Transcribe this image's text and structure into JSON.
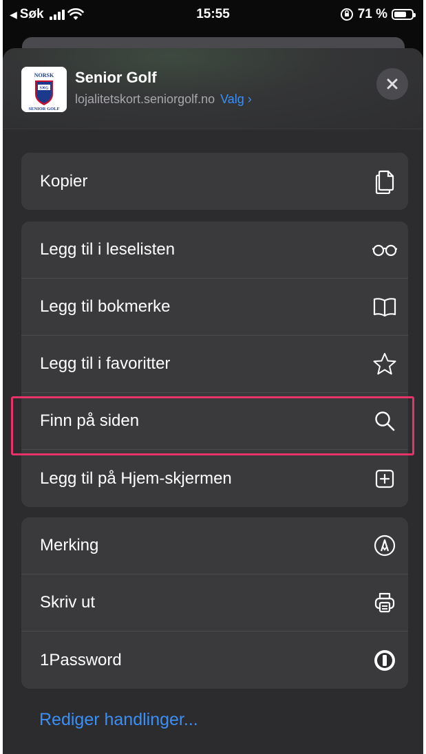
{
  "status_bar": {
    "back_label": "Søk",
    "time": "15:55",
    "battery_text": "71 %",
    "battery_level": 0.71
  },
  "header": {
    "title": "Senior Golf",
    "domain": "lojalitetskort.seniorgolf.no",
    "options_label": "Valg ›",
    "logo_text": "NORSK S✕G SENIOR GOLF"
  },
  "group1": [
    {
      "label": "Kopier",
      "icon": "copy-icon"
    }
  ],
  "group2": [
    {
      "label": "Legg til i leselisten",
      "icon": "glasses-icon"
    },
    {
      "label": "Legg til bokmerke",
      "icon": "book-icon"
    },
    {
      "label": "Legg til i favoritter",
      "icon": "star-icon"
    },
    {
      "label": "Finn på siden",
      "icon": "search-icon"
    },
    {
      "label": "Legg til på Hjem-skjermen",
      "icon": "add-square-icon",
      "highlighted": true
    }
  ],
  "group3": [
    {
      "label": "Merking",
      "icon": "markup-icon"
    },
    {
      "label": "Skriv ut",
      "icon": "print-icon"
    },
    {
      "label": "1Password",
      "icon": "1password-icon"
    }
  ],
  "edit_actions_label": "Rediger handlinger...",
  "colors": {
    "accent": "#3b8ff6",
    "highlight": "#e8336a",
    "sheet": "#2c2c2e",
    "row": "#3a3a3c"
  }
}
